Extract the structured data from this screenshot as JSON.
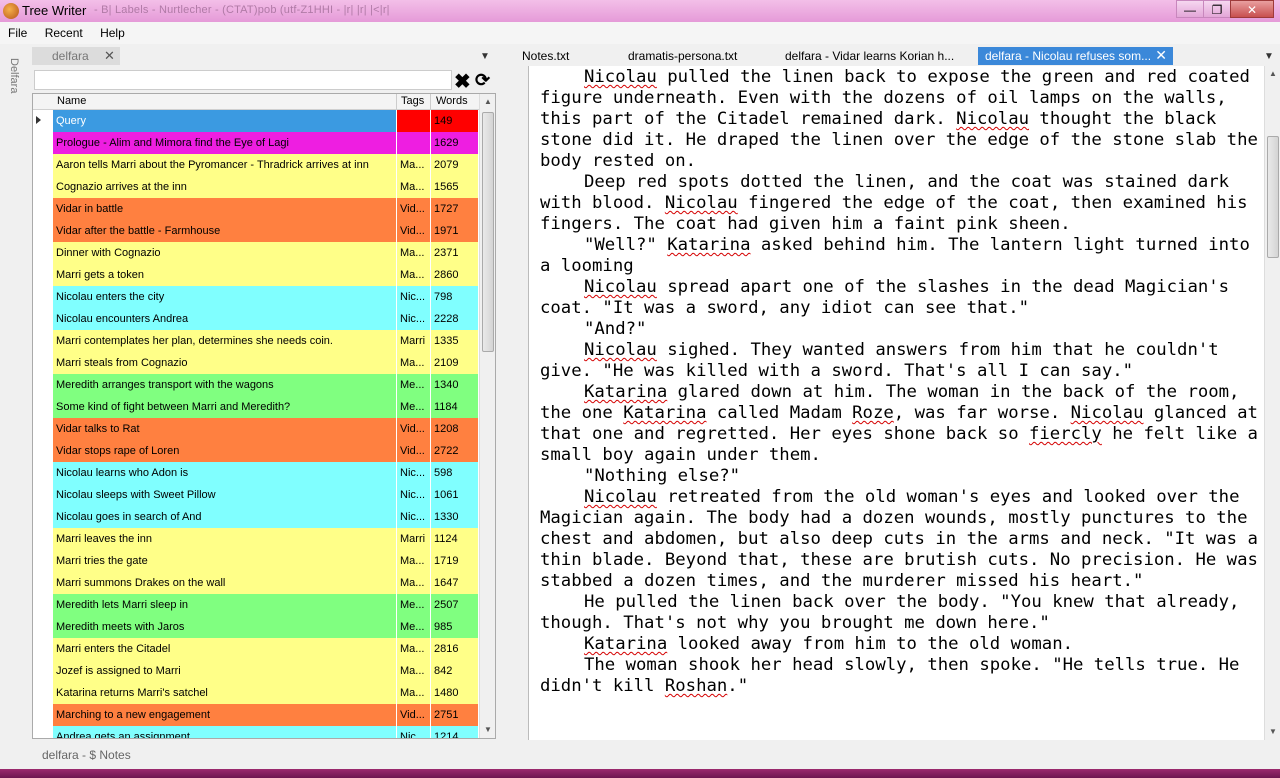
{
  "window": {
    "title": "Tree Writer",
    "faded_title": "- B| Labels - Nurtlecher - (CTAT)pob (utf-Z1HHI - |r| |r| |<|r|",
    "min_icon": "—",
    "max_icon": "❐",
    "close_icon": "✕"
  },
  "menu": [
    "File",
    "Recent",
    "Help"
  ],
  "side_label": "Delfara",
  "left_tab": {
    "label": "delfara",
    "close": "✕"
  },
  "dropdown_glyph": "▼",
  "search": {
    "value": "",
    "placeholder": "",
    "clear_icon": "✖",
    "refresh_icon": "⟳"
  },
  "tree": {
    "columns": [
      "Name",
      "Tags",
      "Words"
    ],
    "rows": [
      {
        "name": "Query",
        "tags": "",
        "words": "149",
        "color": "#3b9ae1",
        "text_color": "#ffffff",
        "tags_color": "#ff0000",
        "words_color": "#ff0000",
        "expander": true
      },
      {
        "name": "Prologue - Alim and Mimora find the Eye of Lagi",
        "tags": "",
        "words": "1629",
        "color": "#ee1ee1",
        "text_color": "#000000"
      },
      {
        "name": "Aaron tells Marri about the Pyromancer - Thradrick arrives at inn",
        "tags": "Ma...",
        "words": "2079",
        "color": "#ffff88",
        "text_color": "#000000"
      },
      {
        "name": "Cognazio arrives at the inn",
        "tags": "Ma...",
        "words": "1565",
        "color": "#ffff88",
        "text_color": "#000000"
      },
      {
        "name": "Vidar in battle",
        "tags": "Vid...",
        "words": "1727",
        "color": "#ff8040",
        "text_color": "#000000"
      },
      {
        "name": "Vidar after the battle - Farmhouse",
        "tags": "Vid...",
        "words": "1971",
        "color": "#ff8040",
        "text_color": "#000000"
      },
      {
        "name": "Dinner with Cognazio",
        "tags": "Ma...",
        "words": "2371",
        "color": "#ffff88",
        "text_color": "#000000"
      },
      {
        "name": "Marri gets a token",
        "tags": "Ma...",
        "words": "2860",
        "color": "#ffff88",
        "text_color": "#000000"
      },
      {
        "name": "Nicolau enters the city",
        "tags": "Nic...",
        "words": "798",
        "color": "#80ffff",
        "text_color": "#000000"
      },
      {
        "name": "Nicolau encounters Andrea",
        "tags": "Nic...",
        "words": "2228",
        "color": "#80ffff",
        "text_color": "#000000"
      },
      {
        "name": "Marri contemplates her plan, determines she needs coin.",
        "tags": "Marri",
        "words": "1335",
        "color": "#ffff88",
        "text_color": "#000000"
      },
      {
        "name": "Marri steals from Cognazio",
        "tags": "Ma...",
        "words": "2109",
        "color": "#ffff88",
        "text_color": "#000000"
      },
      {
        "name": "Meredith arranges transport with the wagons",
        "tags": "Me...",
        "words": "1340",
        "color": "#80ff80",
        "text_color": "#000000"
      },
      {
        "name": "Some kind of fight between Marri and Meredith?",
        "tags": "Me...",
        "words": "1184",
        "color": "#80ff80",
        "text_color": "#000000"
      },
      {
        "name": "Vidar talks to Rat",
        "tags": "Vid...",
        "words": "1208",
        "color": "#ff8040",
        "text_color": "#000000"
      },
      {
        "name": "Vidar stops rape of Loren",
        "tags": "Vid...",
        "words": "2722",
        "color": "#ff8040",
        "text_color": "#000000"
      },
      {
        "name": "Nicolau learns who Adon is",
        "tags": "Nic...",
        "words": "598",
        "color": "#80ffff",
        "text_color": "#000000"
      },
      {
        "name": "Nicolau sleeps with Sweet Pillow",
        "tags": "Nic...",
        "words": "1061",
        "color": "#80ffff",
        "text_color": "#000000"
      },
      {
        "name": "Nicolau goes in search of And",
        "tags": "Nic...",
        "words": "1330",
        "color": "#80ffff",
        "text_color": "#000000"
      },
      {
        "name": "Marri leaves the inn",
        "tags": "Marri",
        "words": "1124",
        "color": "#ffff88",
        "text_color": "#000000"
      },
      {
        "name": "Marri tries the gate",
        "tags": "Ma...",
        "words": "1719",
        "color": "#ffff88",
        "text_color": "#000000"
      },
      {
        "name": "Marri summons Drakes on the wall",
        "tags": "Ma...",
        "words": "1647",
        "color": "#ffff88",
        "text_color": "#000000"
      },
      {
        "name": "Meredith lets Marri sleep in",
        "tags": "Me...",
        "words": "2507",
        "color": "#80ff80",
        "text_color": "#000000"
      },
      {
        "name": "Meredith meets with Jaros",
        "tags": "Me...",
        "words": "985",
        "color": "#80ff80",
        "text_color": "#000000"
      },
      {
        "name": "Marri enters the Citadel",
        "tags": "Ma...",
        "words": "2816",
        "color": "#ffff88",
        "text_color": "#000000"
      },
      {
        "name": "Jozef is assigned to Marri",
        "tags": "Ma...",
        "words": "842",
        "color": "#ffff88",
        "text_color": "#000000"
      },
      {
        "name": "Katarina returns Marri's satchel",
        "tags": "Ma...",
        "words": "1480",
        "color": "#ffff88",
        "text_color": "#000000"
      },
      {
        "name": "Marching to a new engagement",
        "tags": "Vid...",
        "words": "2751",
        "color": "#ff8040",
        "text_color": "#000000"
      },
      {
        "name": "Andrea gets an assignment",
        "tags": "Nic...",
        "words": "1214",
        "color": "#80ffff",
        "text_color": "#000000"
      }
    ]
  },
  "editor_tabs": [
    {
      "label": "Notes.txt",
      "active": false
    },
    {
      "label": "dramatis-persona.txt",
      "active": false
    },
    {
      "label": "delfara - Vidar learns Korian h...",
      "active": false
    },
    {
      "label": "delfara - Nicolau refuses som...",
      "active": true,
      "close": "✕"
    }
  ],
  "editor_paragraphs": [
    "Nicolau pulled the linen back to expose the green and red coated figure underneath. Even with the dozens of oil lamps on the walls, this part of the Citadel remained dark. Nicolau thought the black stone did it. He draped the linen over the edge of the stone slab the body rested on.",
    "Deep red spots dotted the linen, and the coat was stained dark with blood. Nicolau fingered the edge of the coat, then examined his fingers. The coat had given him a faint pink sheen.",
    "\"Well?\" Katarina asked behind him. The lantern light turned into a looming",
    "Nicolau spread apart one of the slashes in the dead Magician's coat. \"It was a sword, any idiot can see that.\"",
    "\"And?\"",
    "Nicolau sighed. They wanted answers from him that he couldn't give. \"He was killed with a sword. That's all I can say.\"",
    "Katarina glared down at him. The woman in the back of the room, the one Katarina called Madam Roze, was far worse. Nicolau glanced at that one and regretted. Her eyes shone back so fiercly he felt like a small boy again under them.",
    "\"Nothing else?\"",
    "Nicolau retreated from the old woman's eyes and looked over the Magician again. The body had a dozen wounds, mostly punctures to the chest and abdomen, but also deep cuts in the arms and neck. \"It was a thin blade. Beyond that, these are brutish cuts. No precision. He was stabbed a dozen times, and the murderer missed his heart.\"",
    "He pulled the linen back over the body. \"You knew that already, though. That's not why you brought me down here.\"",
    "Katarina looked away from him to the old woman.",
    "The woman shook her head slowly, then spoke. \"He tells true. He didn't kill Roshan.\""
  ],
  "spellcheck_words": [
    "Nicolau",
    "Katarina",
    "Roze",
    "fiercly",
    "Roshan"
  ],
  "status": "delfara - $ Notes"
}
